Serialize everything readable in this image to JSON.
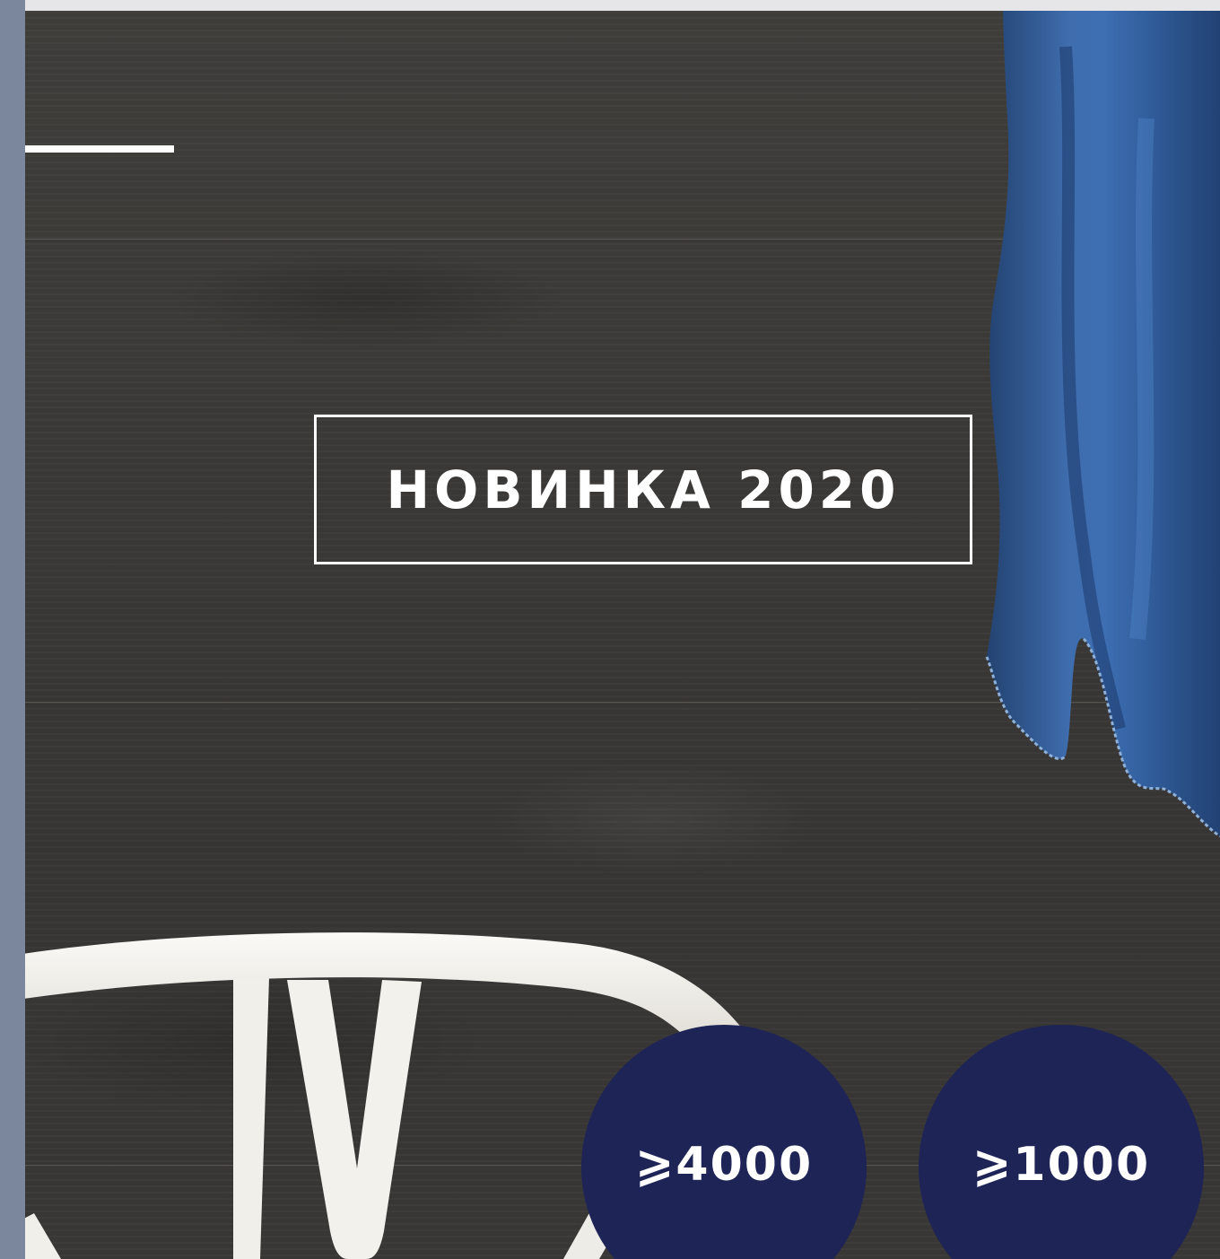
{
  "hero": {
    "badge_text": "НОВИНКА 2020",
    "badge_border_color": "#ffffff"
  },
  "stats": [
    {
      "label": "⩾4000"
    },
    {
      "label": "⩾1000"
    }
  ],
  "colors": {
    "side_strip": "#7a879c",
    "top_strip": "#e6e6e8",
    "wood_background": "#3d3b39",
    "circle_fill": "#1e2456",
    "towel_blue": "#3a66a8",
    "chair_white": "#f3f1ec"
  },
  "images": {
    "background": "dark-wood-plank-wall",
    "towel": "blue-towel-hanging",
    "chair": "white-wishbone-chair"
  }
}
